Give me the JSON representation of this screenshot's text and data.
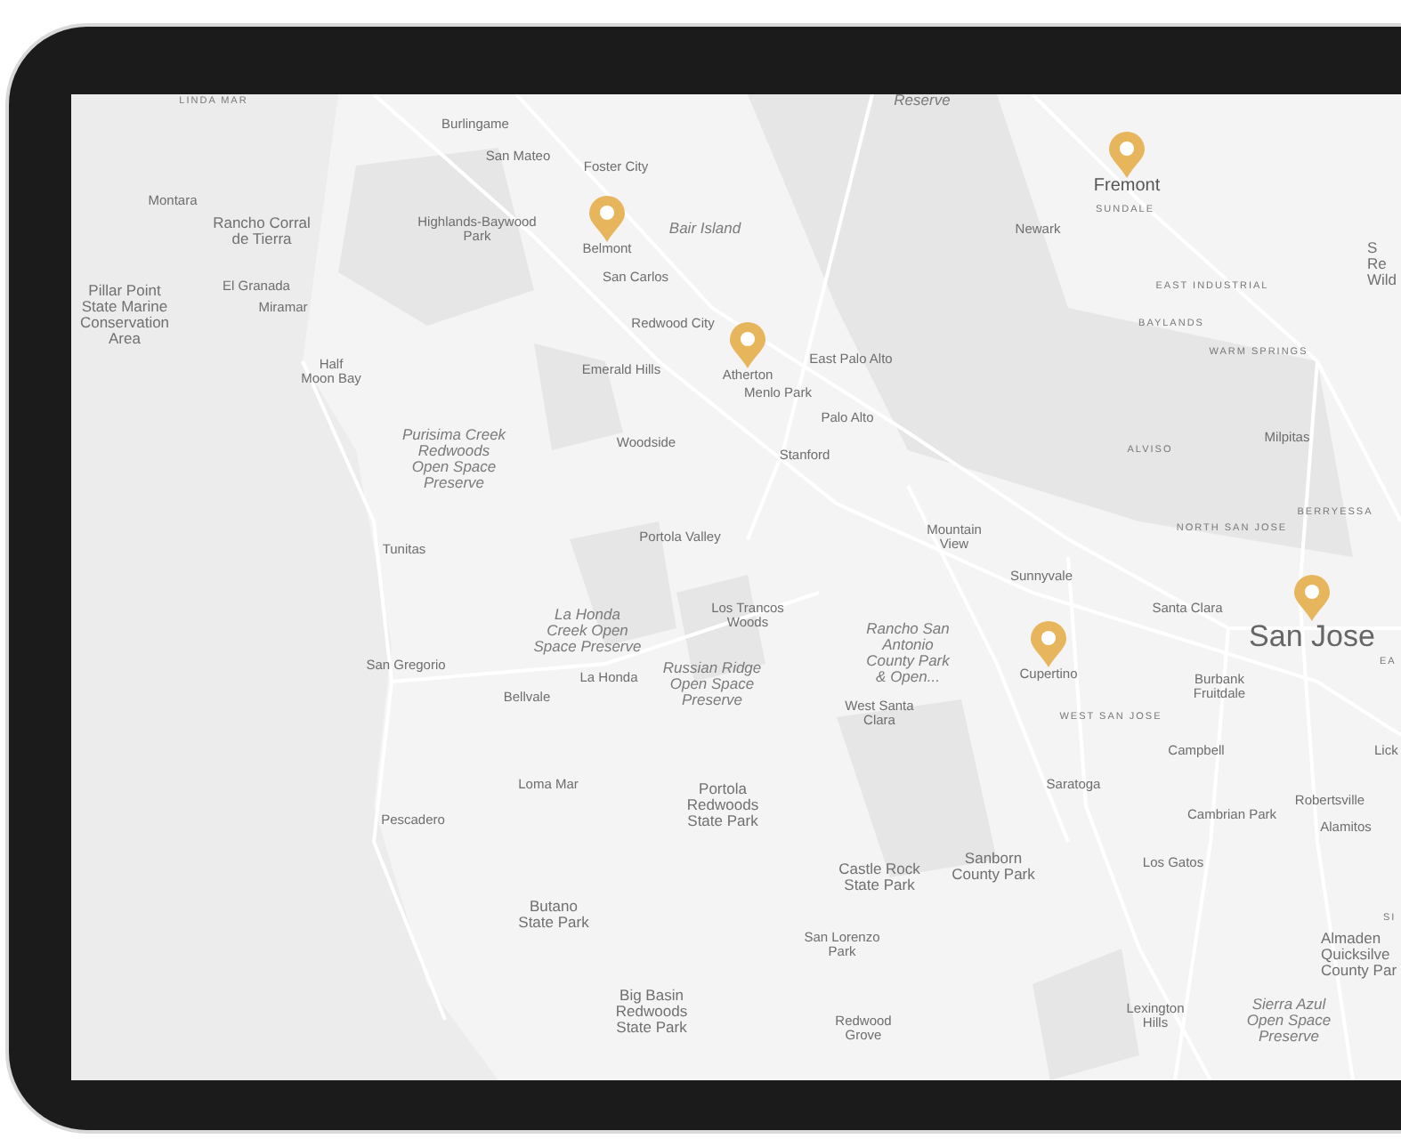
{
  "map": {
    "labels": [
      {
        "text": "LINDA MAR",
        "kind": "district"
      },
      {
        "text": "Burlingame",
        "kind": "place"
      },
      {
        "text": "San Mateo",
        "kind": "place"
      },
      {
        "text": "Foster City",
        "kind": "place"
      },
      {
        "text": "Montara",
        "kind": "place"
      },
      {
        "text": "Rancho Corral\nde Tierra",
        "kind": "area"
      },
      {
        "text": "Highlands-Baywood\nPark",
        "kind": "place"
      },
      {
        "text": "Belmont",
        "kind": "place"
      },
      {
        "text": "Bair Island",
        "kind": "park"
      },
      {
        "text": "San Carlos",
        "kind": "place"
      },
      {
        "text": "Pillar Point\nState Marine\nConservation\nArea",
        "kind": "area"
      },
      {
        "text": "El Granada",
        "kind": "place"
      },
      {
        "text": "Miramar",
        "kind": "place"
      },
      {
        "text": "Redwood City",
        "kind": "place"
      },
      {
        "text": "Emerald Hills",
        "kind": "place"
      },
      {
        "text": "Atherton",
        "kind": "place"
      },
      {
        "text": "Menlo Park",
        "kind": "place"
      },
      {
        "text": "East Palo Alto",
        "kind": "place"
      },
      {
        "text": "Half\nMoon Bay",
        "kind": "place"
      },
      {
        "text": "Palo Alto",
        "kind": "place"
      },
      {
        "text": "Purisima Creek\nRedwoods\nOpen Space\nPreserve",
        "kind": "park"
      },
      {
        "text": "Woodside",
        "kind": "place"
      },
      {
        "text": "Stanford",
        "kind": "place"
      },
      {
        "text": "Reserve",
        "kind": "park"
      },
      {
        "text": "Fremont",
        "kind": "city"
      },
      {
        "text": "SUNDALE",
        "kind": "district"
      },
      {
        "text": "Newark",
        "kind": "place"
      },
      {
        "text": "EAST INDUSTRIAL",
        "kind": "district"
      },
      {
        "text": "BAYLANDS",
        "kind": "district"
      },
      {
        "text": "WARM SPRINGS",
        "kind": "district"
      },
      {
        "text": "Milpitas",
        "kind": "place"
      },
      {
        "text": "ALVISO",
        "kind": "district"
      },
      {
        "text": "BERRYESSA",
        "kind": "district"
      },
      {
        "text": "S\nRe\nWild",
        "kind": "area"
      },
      {
        "text": "Tunitas",
        "kind": "place"
      },
      {
        "text": "Portola Valley",
        "kind": "place"
      },
      {
        "text": "Mountain\nView",
        "kind": "place"
      },
      {
        "text": "NORTH SAN JOSE",
        "kind": "district"
      },
      {
        "text": "Sunnyvale",
        "kind": "place"
      },
      {
        "text": "La Honda\nCreek Open\nSpace Preserve",
        "kind": "park"
      },
      {
        "text": "Los Trancos\nWoods",
        "kind": "place"
      },
      {
        "text": "Santa Clara",
        "kind": "place"
      },
      {
        "text": "Rancho San\nAntonio\nCounty Park\n& Open...",
        "kind": "park"
      },
      {
        "text": "San Jose",
        "kind": "major"
      },
      {
        "text": "EA",
        "kind": "district"
      },
      {
        "text": "Cupertino",
        "kind": "place"
      },
      {
        "text": "San Gregorio",
        "kind": "place"
      },
      {
        "text": "Bellvale",
        "kind": "place"
      },
      {
        "text": "La Honda",
        "kind": "place"
      },
      {
        "text": "Russian Ridge\nOpen Space\nPreserve",
        "kind": "park"
      },
      {
        "text": "Burbank\nFruitdale",
        "kind": "place"
      },
      {
        "text": "West Santa\nClara",
        "kind": "place"
      },
      {
        "text": "WEST SAN JOSE",
        "kind": "district"
      },
      {
        "text": "Campbell",
        "kind": "place"
      },
      {
        "text": "Lick",
        "kind": "place"
      },
      {
        "text": "Loma Mar",
        "kind": "place"
      },
      {
        "text": "Portola\nRedwoods\nState Park",
        "kind": "area"
      },
      {
        "text": "Saratoga",
        "kind": "place"
      },
      {
        "text": "Robertsville",
        "kind": "place"
      },
      {
        "text": "Pescadero",
        "kind": "place"
      },
      {
        "text": "Cambrian Park",
        "kind": "place"
      },
      {
        "text": "Alamitos",
        "kind": "place"
      },
      {
        "text": "Castle Rock\nState Park",
        "kind": "area"
      },
      {
        "text": "Sanborn\nCounty Park",
        "kind": "area"
      },
      {
        "text": "Los Gatos",
        "kind": "place"
      },
      {
        "text": "Butano\nState Park",
        "kind": "area"
      },
      {
        "text": "SI",
        "kind": "district"
      },
      {
        "text": "San Lorenzo\nPark",
        "kind": "place"
      },
      {
        "text": "Almaden\nQuicksilve\nCounty Par",
        "kind": "area"
      },
      {
        "text": "Big Basin\nRedwoods\nState Park",
        "kind": "area"
      },
      {
        "text": "Redwood\nGrove",
        "kind": "place"
      },
      {
        "text": "Lexington\nHills",
        "kind": "place"
      },
      {
        "text": "Sierra Azul\nOpen Space\nPreserve",
        "kind": "park"
      }
    ]
  }
}
